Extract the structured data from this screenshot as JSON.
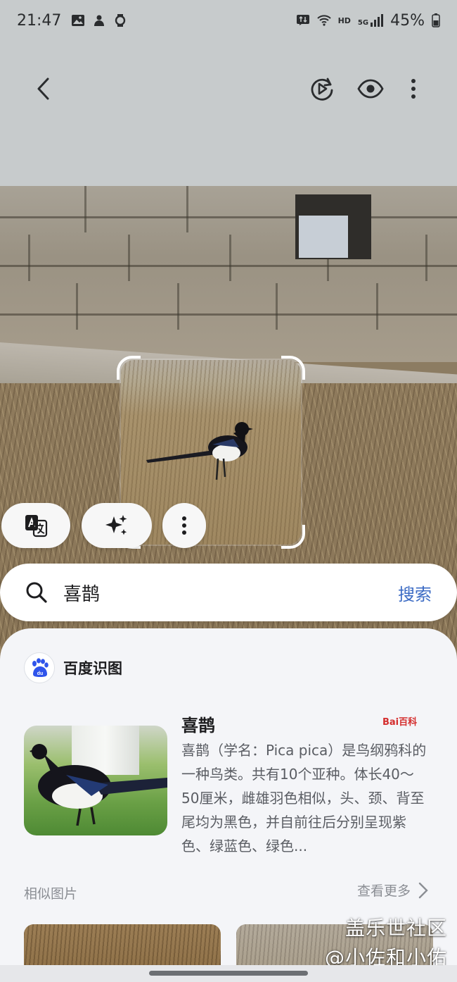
{
  "status_bar": {
    "time": "21:47",
    "network": "5G",
    "hd": "HD",
    "battery": "45%",
    "left_icons": [
      "gallery-icon",
      "app-icon",
      "watch-icon"
    ],
    "right_icons": [
      "data-transfer-icon",
      "wifi-icon",
      "signal-icon",
      "battery-icon"
    ]
  },
  "toolbar": {
    "back_icon": "chevron-left-icon",
    "actions": [
      "motion-photo-icon",
      "eye-icon",
      "more-vertical-icon"
    ]
  },
  "selection_actions": {
    "translate_icon": "translate-icon",
    "ai_icon": "sparkle-icon",
    "more_icon": "more-vertical-icon"
  },
  "search": {
    "query": "喜鹊",
    "action_label": "搜索"
  },
  "result": {
    "provider_name": "百度识图",
    "title": "喜鹊",
    "source_badge": "Bai百科",
    "description": "喜鹊（学名：Pica pica）是鸟纲鸦科的一种鸟类。共有10个亚种。体长40～50厘米，雌雄羽色相似，头、颈、背至尾均为黑色，并自前往后分别呈现紫色、绿蓝色、绿色...",
    "similar_label": "相似图片",
    "see_more_label": "查看更多"
  },
  "watermark": {
    "line1": "盖乐世社区",
    "line2": "@小佐和小佑"
  },
  "colors": {
    "accent": "#3c6bc4",
    "sheet_bg": "#f4f5f8",
    "baidu_blue": "#2f54eb",
    "baike_red": "#d42d2d"
  }
}
